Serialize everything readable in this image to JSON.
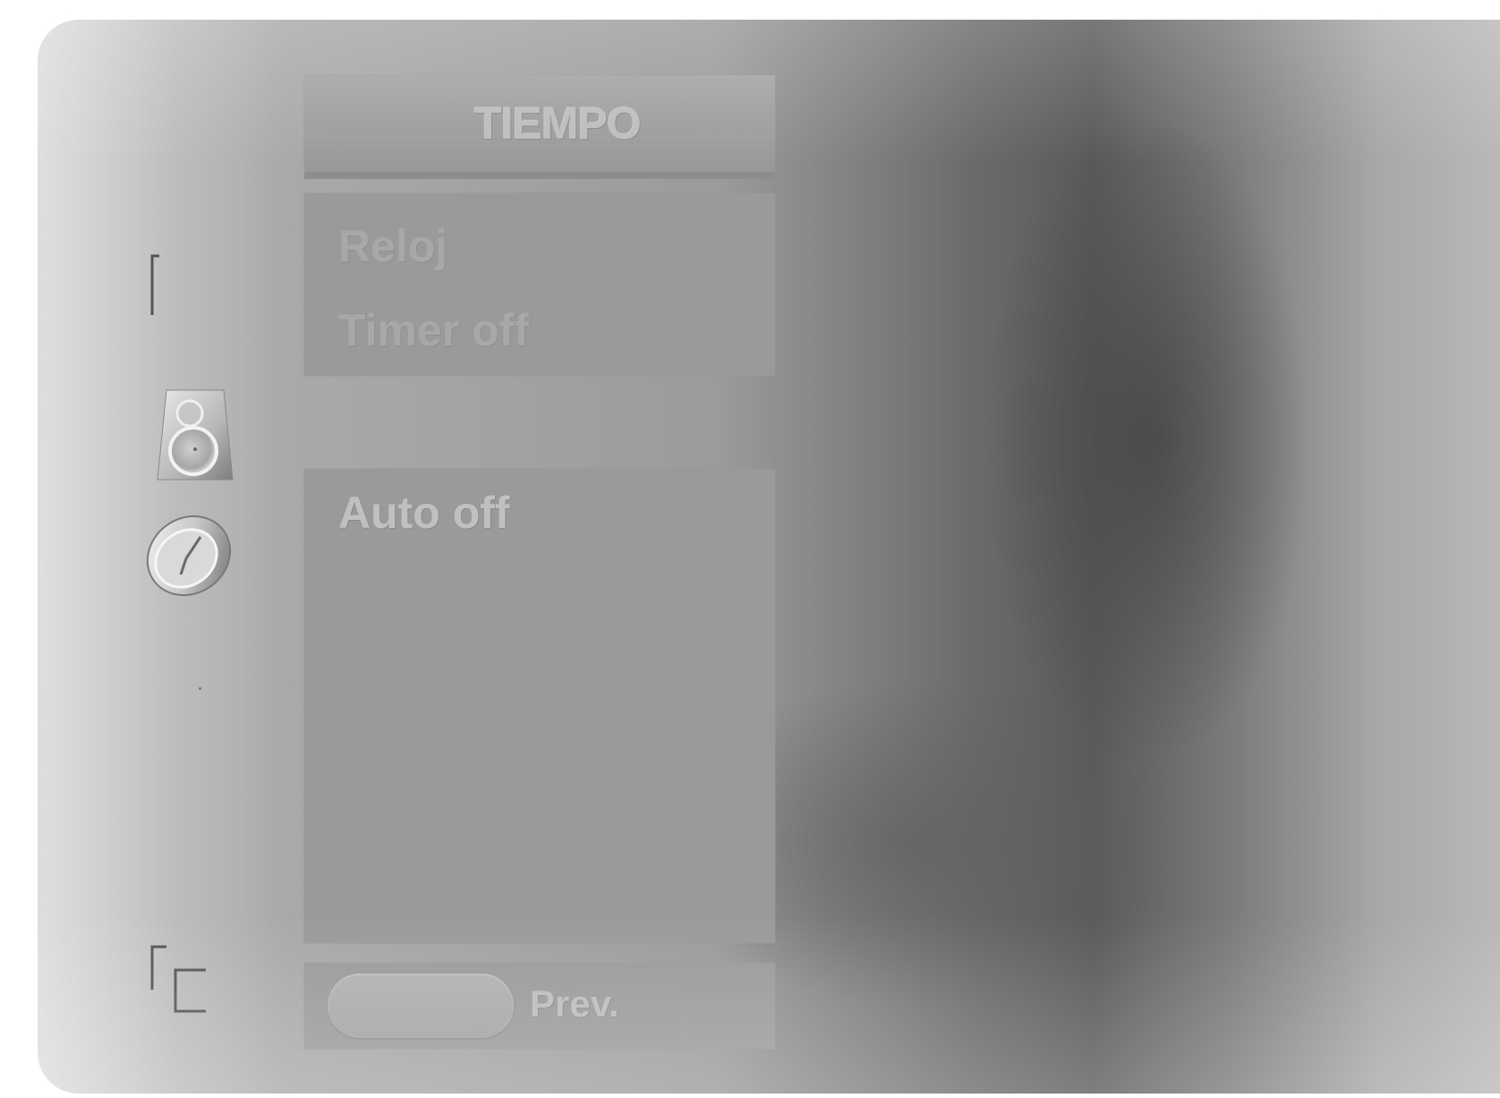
{
  "menu": {
    "title": "TIEMPO",
    "items": [
      {
        "label": "Reloj"
      },
      {
        "label": "Timer off"
      }
    ],
    "options": [
      {
        "label": "Auto off"
      }
    ],
    "footer": {
      "prev_label": "Prev."
    }
  },
  "icons": {
    "rail": [
      "bracket-icon",
      "speaker-icon",
      "clock-icon",
      "corner-icon"
    ]
  },
  "colors": {
    "panel": "#9a9a9a",
    "title_text": "#bdbdbd",
    "item_text": "#a8a8a8",
    "option_text": "#c0c0c0"
  }
}
